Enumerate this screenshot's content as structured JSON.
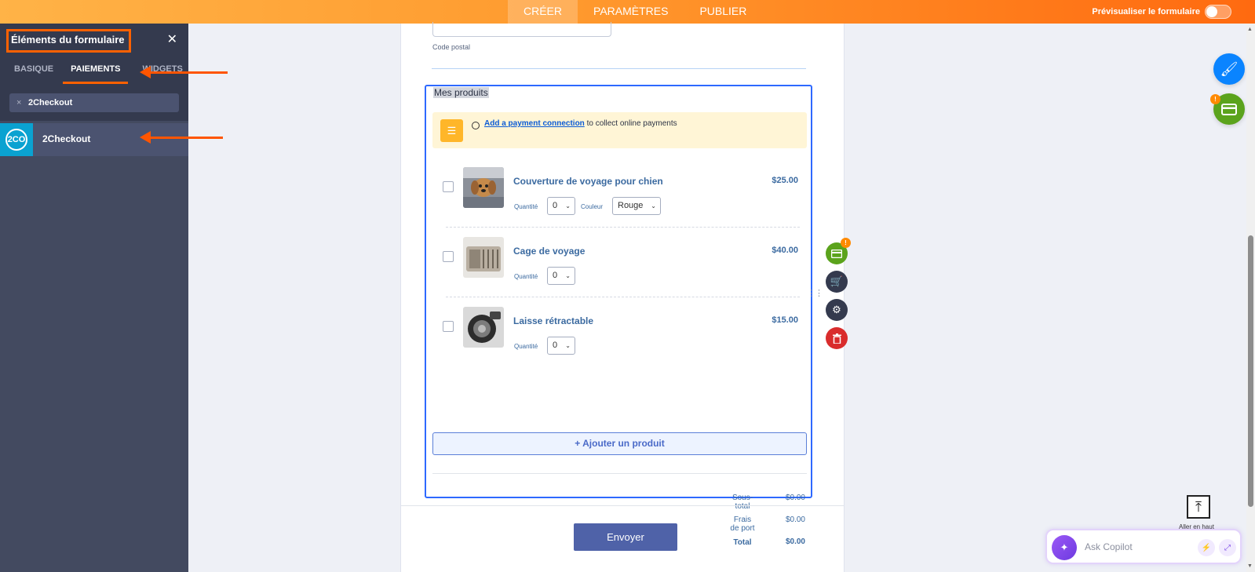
{
  "topbar": {
    "tabs": [
      {
        "label": "CRÉER",
        "active": true
      },
      {
        "label": "PARAMÈTRES",
        "active": false
      },
      {
        "label": "PUBLIER",
        "active": false
      }
    ],
    "preview_label": "Prévisualiser le formulaire"
  },
  "panel": {
    "title": "Éléments du formulaire",
    "close": "✕",
    "tabs": [
      {
        "label": "BASIQUE",
        "active": false
      },
      {
        "label": "PAIEMENTS",
        "active": true
      },
      {
        "label": "WIDGETS",
        "active": false
      }
    ],
    "search": {
      "value": "2Checkout",
      "clear": "×"
    },
    "items": [
      {
        "label": "2Checkout",
        "logo_text": "2CO"
      }
    ]
  },
  "form": {
    "zip_label": "Code postal",
    "widget_title": "Mes produits",
    "notice": {
      "link": "Add a payment connection",
      "text": " to collect online payments"
    },
    "products": [
      {
        "name": "Couverture de voyage pour chien",
        "price": "$25.00",
        "qty_label": "Quantité",
        "qty": "0",
        "color_label": "Couleur",
        "color": "Rouge"
      },
      {
        "name": "Cage de voyage",
        "price": "$40.00",
        "qty_label": "Quantité",
        "qty": "0"
      },
      {
        "name": "Laisse rétractable",
        "price": "$15.00",
        "qty_label": "Quantité",
        "qty": "0"
      }
    ],
    "add_product": "+ Ajouter un produit",
    "summary": {
      "subtotal_label1": "Sous-",
      "subtotal_label2": "total",
      "subtotal": "$0.00",
      "shipping_label1": "Frais",
      "shipping_label2": "de port",
      "shipping": "$0.00",
      "total_label": "Total",
      "total": "$0.00"
    },
    "submit": "Envoyer"
  },
  "tools": {
    "badge": "!"
  },
  "go_top": "Aller en haut",
  "copilot": {
    "placeholder": "Ask Copilot"
  },
  "colors": {
    "accent": "#ff6100",
    "widget_border": "#2e69ff",
    "submit": "#4f62a8",
    "payment_green": "#5ba31c",
    "delete_red": "#d92c2c"
  }
}
